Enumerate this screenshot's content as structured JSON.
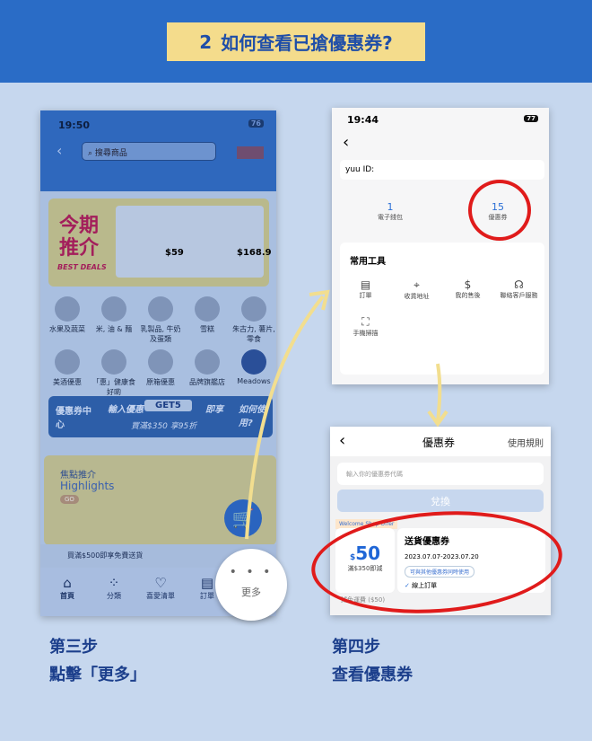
{
  "header": {
    "step": "2",
    "title": "如何查看已搶優惠券?"
  },
  "left_phone": {
    "time": "19:50",
    "battery": "76",
    "search_placeholder": "搜尋商品",
    "banner": {
      "title": "今期推介",
      "subtitle": "BEST DEALS",
      "price1": "$59",
      "price2": "$168.9"
    },
    "categories": [
      "水果及蔬菜",
      "米, 油 & 麵",
      "乳製品, 牛奶及蛋類",
      "雪糕",
      "朱古力, 薯片, 零食",
      "美酒優惠",
      "「惠」健康食好啲",
      "原箱優惠",
      "品牌旗艦店",
      "Meadows"
    ],
    "coupon_banner": {
      "left": "優惠券中心",
      "prompt": "輸入優惠",
      "code": "GET5",
      "suffix": "即享",
      "detail": "買滿$350 享95折",
      "right": "如何使用?"
    },
    "highlights": {
      "title": "焦點推介",
      "subtitle": "Highlights",
      "go": "GO"
    },
    "free_delivery": "買滿$500即享免費送貨",
    "nav": [
      "首頁",
      "分類",
      "喜愛清單",
      "訂單"
    ],
    "more": "更多"
  },
  "profile_phone": {
    "time": "19:44",
    "battery": "77",
    "yuu_id": "yuu ID:",
    "wallet_count": "1",
    "wallet_label": "電子錢包",
    "coupon_count": "15",
    "coupon_label": "優惠券",
    "tools_title": "常用工具",
    "tools": [
      "訂單",
      "收貨地址",
      "我的售後",
      "聯絡客戶服務",
      "手機掃描"
    ]
  },
  "coupon_phone": {
    "title": "優惠券",
    "rules": "使用規則",
    "input_placeholder": "輸入你的優惠券代碼",
    "redeem": "兌換",
    "tag": "Welcome Shop Offer",
    "amount": "50",
    "currency": "$",
    "condition": "滿$350即減",
    "name": "送貨優惠券",
    "dates": "2023.07.07-2023.07.20",
    "combinable": "可與其他優惠券同時使用",
    "scope": "線上訂單",
    "footer": "減免運費 ($50)"
  },
  "captions": {
    "left_line1": "第三步",
    "left_line2": "點擊「更多」",
    "right_line1": "第四步",
    "right_line2": "查看優惠券"
  }
}
